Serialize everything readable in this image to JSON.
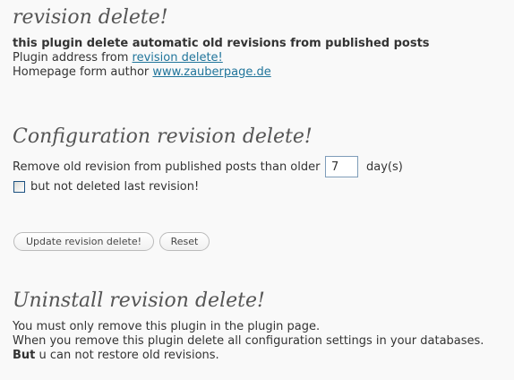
{
  "main_title": "revision delete!",
  "description": "this plugin delete automatic old revisions from published posts",
  "plugin_address": {
    "label": "Plugin address from ",
    "link_text": "revision delete!"
  },
  "homepage": {
    "label": "Homepage form author ",
    "link_text": "www.zauberpage.de"
  },
  "config": {
    "title": "Configuration revision delete!",
    "remove_label": "Remove old revision from published posts than older",
    "days_value": "7",
    "days_unit": "day(s)",
    "keep_last_label": "but not deleted last revision!",
    "keep_last_checked": false
  },
  "buttons": {
    "update": "Update revision delete!",
    "reset": "Reset"
  },
  "uninstall": {
    "title": "Uninstall revision delete!",
    "line1": "You must only remove this plugin in the plugin page.",
    "line2": "When you remove this plugin delete all configuration settings in your databases.",
    "line3_bold": "But",
    "line3_rest": " u can not restore old revisions."
  }
}
